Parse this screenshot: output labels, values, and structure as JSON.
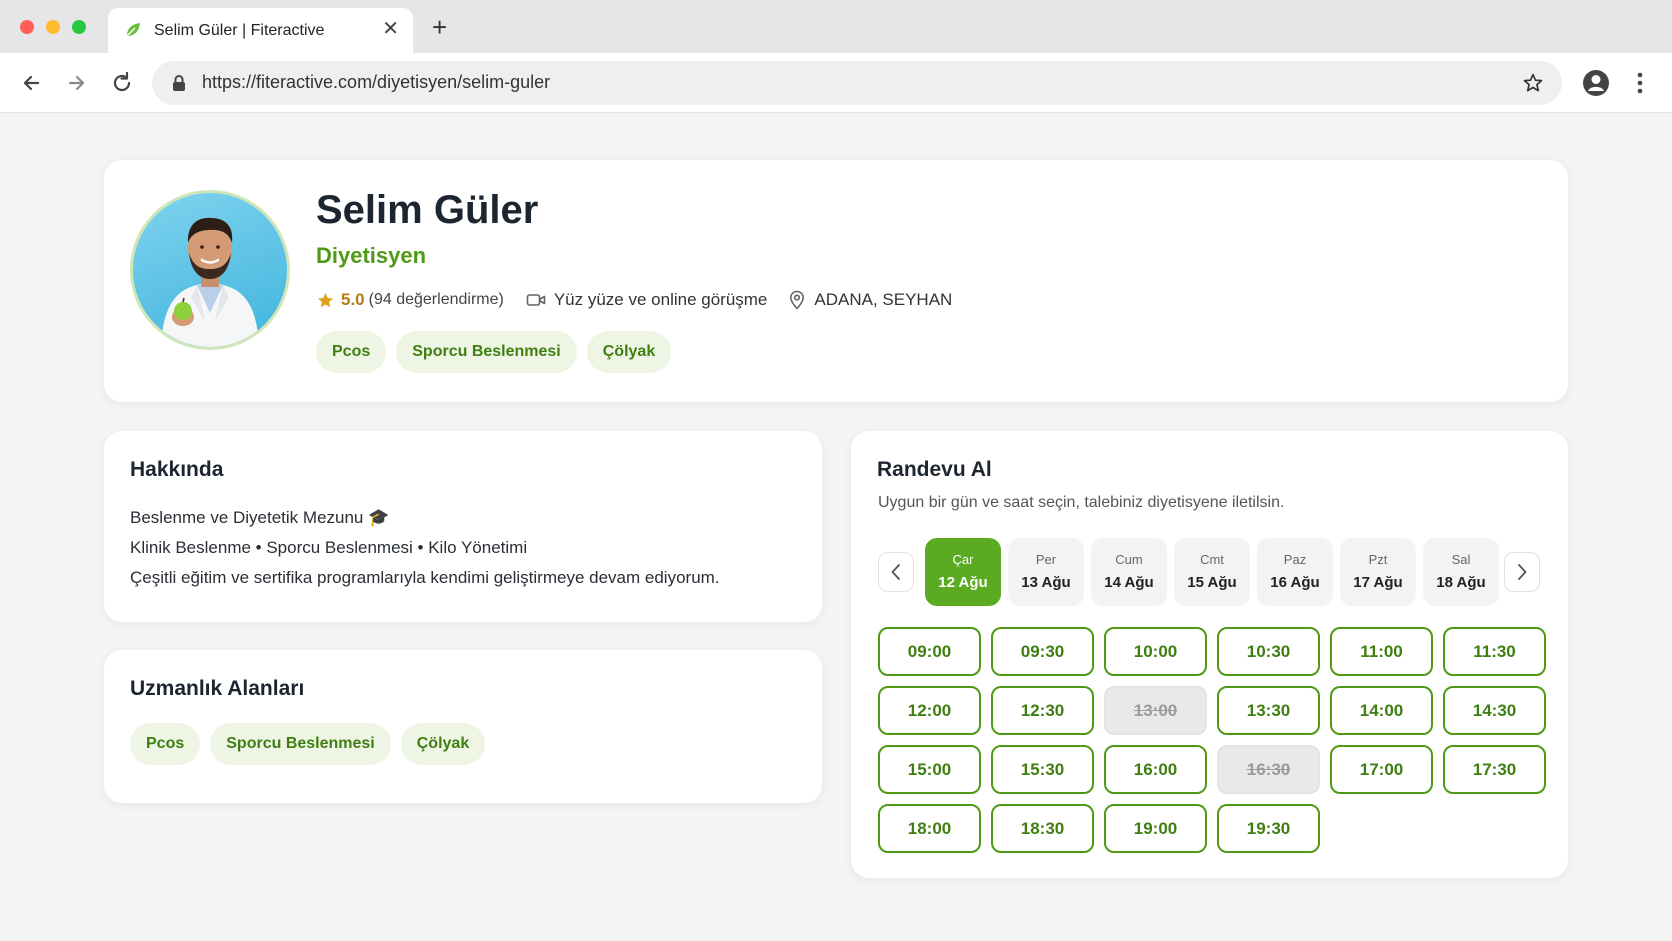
{
  "browser": {
    "tab_title": "Selim Güler | Fiteractive",
    "url": "https://fiteractive.com/diyetisyen/selim-guler",
    "icons": [
      "leaf-icon",
      "close-icon",
      "plus-icon",
      "back-arrow-icon",
      "forward-arrow-icon",
      "reload-icon",
      "lock-icon",
      "star-icon",
      "profile-icon",
      "more-vert-icon"
    ]
  },
  "profile": {
    "name": "Selim Güler",
    "role": "Diyetisyen",
    "rating": "5.0",
    "rating_count": "(94 değerlendirme)",
    "meeting_type": "Yüz yüze ve online görüşme",
    "location": "ADANA, SEYHAN",
    "tags": [
      "Pcos",
      "Sporcu Beslenmesi",
      "Çölyak"
    ]
  },
  "about": {
    "title": "Hakkında",
    "lines": [
      "Beslenme ve Diyetetik Mezunu 🎓",
      "Klinik Beslenme • Sporcu Beslenmesi • Kilo Yönetimi",
      "Çeşitli eğitim ve sertifika programlarıyla kendimi geliştirmeye devam ediyorum."
    ]
  },
  "specialties": {
    "title": "Uzmanlık Alanları",
    "tags": [
      "Pcos",
      "Sporcu Beslenmesi",
      "Çölyak"
    ]
  },
  "booking": {
    "title": "Randevu Al",
    "subtitle": "Uygun bir gün ve saat seçin, talebiniz diyetisyene iletilsin.",
    "days": [
      {
        "name": "Çar",
        "date": "12 Ağu",
        "selected": true
      },
      {
        "name": "Per",
        "date": "13 Ağu",
        "selected": false
      },
      {
        "name": "Cum",
        "date": "14 Ağu",
        "selected": false
      },
      {
        "name": "Cmt",
        "date": "15 Ağu",
        "selected": false
      },
      {
        "name": "Paz",
        "date": "16 Ağu",
        "selected": false
      },
      {
        "name": "Pzt",
        "date": "17 Ağu",
        "selected": false
      },
      {
        "name": "Sal",
        "date": "18 Ağu",
        "selected": false
      }
    ],
    "slots": [
      {
        "time": "09:00",
        "available": true
      },
      {
        "time": "09:30",
        "available": true
      },
      {
        "time": "10:00",
        "available": true
      },
      {
        "time": "10:30",
        "available": true
      },
      {
        "time": "11:00",
        "available": true
      },
      {
        "time": "11:30",
        "available": true
      },
      {
        "time": "12:00",
        "available": true
      },
      {
        "time": "12:30",
        "available": true
      },
      {
        "time": "13:00",
        "available": false
      },
      {
        "time": "13:30",
        "available": true
      },
      {
        "time": "14:00",
        "available": true
      },
      {
        "time": "14:30",
        "available": true
      },
      {
        "time": "15:00",
        "available": true
      },
      {
        "time": "15:30",
        "available": true
      },
      {
        "time": "16:00",
        "available": true
      },
      {
        "time": "16:30",
        "available": false
      },
      {
        "time": "17:00",
        "available": true
      },
      {
        "time": "17:30",
        "available": true
      },
      {
        "time": "18:00",
        "available": true
      },
      {
        "time": "18:30",
        "available": true
      },
      {
        "time": "19:00",
        "available": true
      },
      {
        "time": "19:30",
        "available": true
      }
    ]
  },
  "colors": {
    "accent": "#5aaa22",
    "accent_text": "#3f7f12",
    "chip_bg": "#eef5e4",
    "star": "#e0a21c",
    "page_bg": "#f4f4f3"
  }
}
